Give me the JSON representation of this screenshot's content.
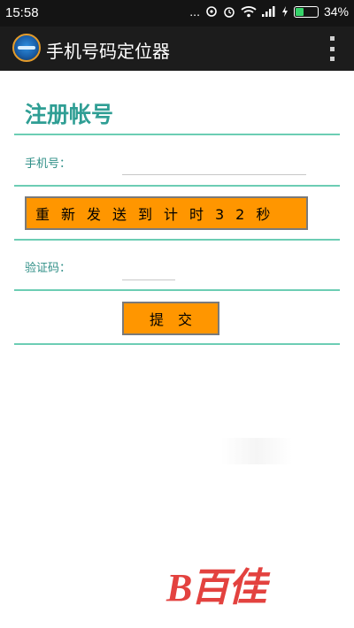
{
  "status_bar": {
    "time": "15:58",
    "dots": "...",
    "battery_percent": "34%",
    "battery_level": 0.34
  },
  "app_bar": {
    "title": "手机号码定位器"
  },
  "form": {
    "heading": "注册帐号",
    "phone_label": "手机号：",
    "phone_value": "",
    "resend_button": "重新发送到计时32秒",
    "code_label": "验证码：",
    "code_value": "",
    "submit_button": "提交"
  },
  "watermark": {
    "text": "B百佳"
  },
  "colors": {
    "accent": "#2f9e94",
    "divider": "#6ccdb4",
    "button": "#ff9600",
    "status_bar": "#141414",
    "app_bar": "#1c1c1c"
  }
}
